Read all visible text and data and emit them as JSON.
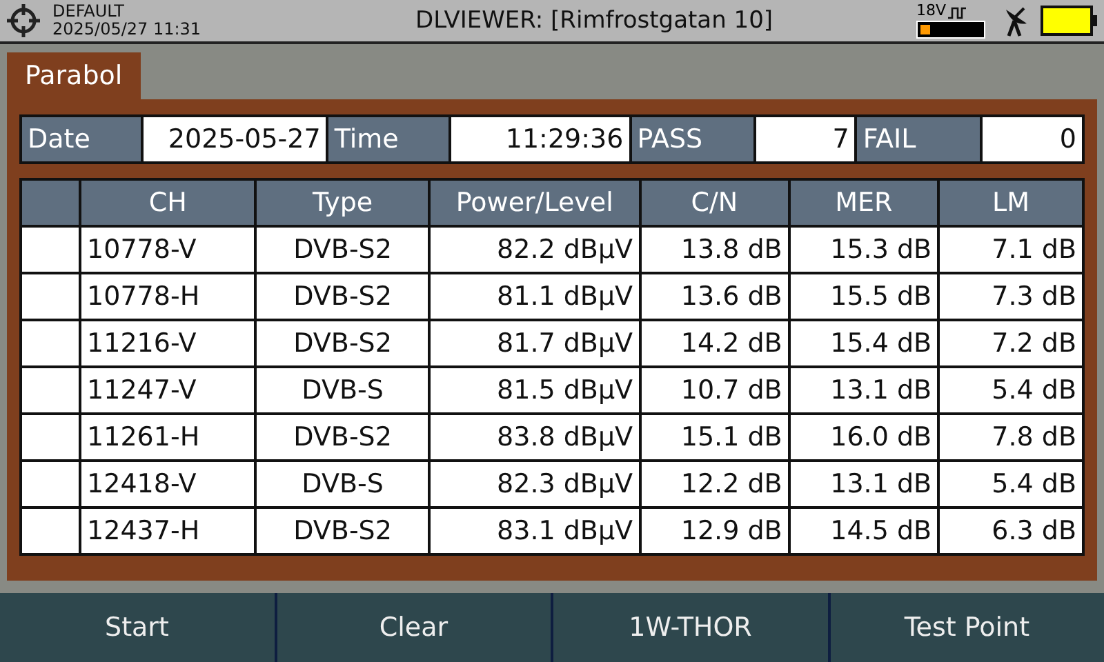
{
  "status_bar": {
    "profile": "DEFAULT",
    "datetime": "2025/05/27 11:31",
    "title": "DLVIEWER: [Rimfrostgatan 10]",
    "voltage": "18V"
  },
  "tabs": [
    {
      "label": "Parabol",
      "selected": true
    }
  ],
  "info": [
    {
      "label": "Date",
      "value": "2025-05-27"
    },
    {
      "label": "Time",
      "value": "11:29:36"
    },
    {
      "label": "PASS",
      "value": "7"
    },
    {
      "label": "FAIL",
      "value": "0"
    }
  ],
  "table": {
    "columns": [
      "CH",
      "Type",
      "Power/Level",
      "C/N",
      "MER",
      "LM"
    ],
    "rows": [
      [
        "10778-V",
        "DVB-S2",
        "82.2 dBµV",
        "13.8 dB",
        "15.3 dB",
        "7.1 dB"
      ],
      [
        "10778-H",
        "DVB-S2",
        "81.1 dBµV",
        "13.6 dB",
        "15.5 dB",
        "7.3 dB"
      ],
      [
        "11216-V",
        "DVB-S2",
        "81.7 dBµV",
        "14.2 dB",
        "15.4 dB",
        "7.2 dB"
      ],
      [
        "11247-V",
        "DVB-S",
        "81.5 dBµV",
        "10.7 dB",
        "13.1 dB",
        "5.4 dB"
      ],
      [
        "11261-H",
        "DVB-S2",
        "83.8 dBµV",
        "15.1 dB",
        "16.0 dB",
        "7.8 dB"
      ],
      [
        "12418-V",
        "DVB-S",
        "82.3 dBµV",
        "12.2 dB",
        "13.1 dB",
        "5.4 dB"
      ],
      [
        "12437-H",
        "DVB-S2",
        "83.1 dBµV",
        "12.9 dB",
        "14.5 dB",
        "6.3 dB"
      ]
    ]
  },
  "softkeys": [
    "Start",
    "Clear",
    "1W-THOR",
    "Test Point"
  ]
}
